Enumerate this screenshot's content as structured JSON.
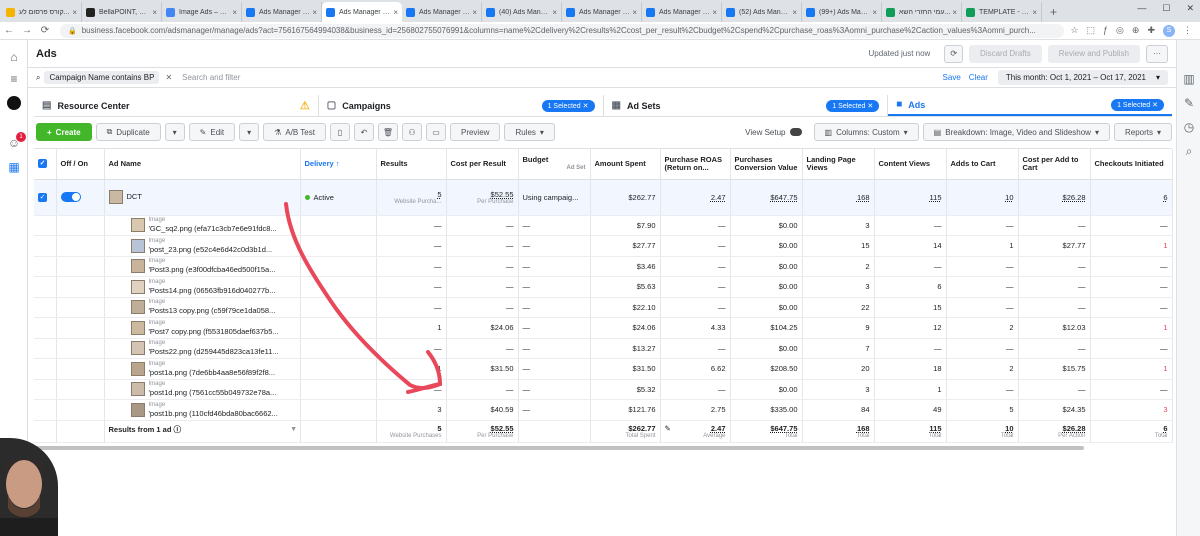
{
  "browser": {
    "tabs": [
      {
        "title": "קורס פרסום לע...",
        "color": "#f4b400"
      },
      {
        "title": "BellaPOINT, Onl...",
        "color": "#222222"
      },
      {
        "title": "Image Ads – Go...",
        "color": "#4285f4"
      },
      {
        "title": "Ads Manager - ...",
        "color": "#1877f2"
      },
      {
        "title": "Ads Manager - ...",
        "color": "#1877f2",
        "active": true
      },
      {
        "title": "Ads Manager - ...",
        "color": "#1877f2"
      },
      {
        "title": "(40) Ads Manag...",
        "color": "#1877f2"
      },
      {
        "title": "Ads Manager - ...",
        "color": "#1877f2"
      },
      {
        "title": "Ads Manager - ...",
        "color": "#1877f2"
      },
      {
        "title": "(52) Ads Manag...",
        "color": "#1877f2"
      },
      {
        "title": "(99+) Ads Mana...",
        "color": "#1877f2"
      },
      {
        "title": "עמי החזרי השא...",
        "color": "#0f9d58"
      },
      {
        "title": "TEMPLATE - KP...",
        "color": "#0f9d58"
      }
    ],
    "new_tab": "+",
    "url": "business.facebook.com/adsmanager/manage/ads?act=756167564994038&business_id=256802755076991&columns=name%2Cdelivery%2Cresults%2Ccost_per_result%2Cbudget%2Cspend%2Cpurchase_roas%3Aomni_purchase%2Caction_values%3Aomni_purch...",
    "profile_initial": "S"
  },
  "rail": {
    "notification_count": "1"
  },
  "header": {
    "title": "Ads",
    "updated": "Updated just now",
    "discard": "Discard Drafts",
    "review": "Review and Publish",
    "more": "···"
  },
  "search": {
    "chip": "Campaign Name contains BP",
    "placeholder": "Search and filter",
    "save": "Save",
    "clear": "Clear",
    "date_range": "This month: Oct 1, 2021 – Oct 17, 2021"
  },
  "levels": {
    "resource_center": "Resource Center",
    "campaigns": "Campaigns",
    "campaigns_selected": "1 Selected",
    "ad_sets": "Ad Sets",
    "ad_sets_selected": "1 Selected",
    "ads": "Ads",
    "ads_selected": "1 Selected"
  },
  "toolbar": {
    "create": "Create",
    "duplicate": "Duplicate",
    "edit": "Edit",
    "ab_test": "A/B Test",
    "preview": "Preview",
    "rules": "Rules",
    "view_setup": "View Setup",
    "columns": "Columns: Custom",
    "breakdown": "Breakdown: Image, Video and Slideshow",
    "reports": "Reports"
  },
  "table": {
    "headers": {
      "onoff": "Off / On",
      "name": "Ad Name",
      "delivery": "Delivery ↑",
      "results": "Results",
      "cpr": "Cost per Result",
      "budget": "Budget",
      "budget_sub": "Ad Set",
      "spent": "Amount Spent",
      "roas": "Purchase ROAS (Return on...",
      "pcv": "Purchases Conversion Value",
      "lpv": "Landing Page Views",
      "cv": "Content Views",
      "atc": "Adds to Cart",
      "cpatc": "Cost per Add to Cart",
      "ci": "Checkouts Initiated"
    },
    "parent": {
      "name": "DCT",
      "delivery": "Active",
      "results": "5",
      "results_sub": "Website Purcha...",
      "cpr": "$52.55",
      "cpr_sub": "Per Purchase",
      "budget": "Using campaig...",
      "spent": "$262.77",
      "roas": "2.47",
      "pcv": "$647.75",
      "lpv": "168",
      "cv": "115",
      "atc": "10",
      "cpatc": "$26.28",
      "ci": "6"
    },
    "image_label": "Image",
    "rows": [
      {
        "name": "'GC_sq2.png (efa71c3cb7e6e91fdc8...",
        "results": "—",
        "cpr": "—",
        "budget": "—",
        "spent": "$7.90",
        "roas": "—",
        "pcv": "$0.00",
        "lpv": "3",
        "cv": "—",
        "atc": "—",
        "cpatc": "—",
        "ci": "—"
      },
      {
        "name": "'post_23.png (e52c4e6d42c0d3b1d...",
        "results": "—",
        "cpr": "—",
        "budget": "—",
        "spent": "$27.77",
        "roas": "—",
        "pcv": "$0.00",
        "lpv": "15",
        "cv": "14",
        "atc": "1",
        "cpatc": "$27.77",
        "ci": "1"
      },
      {
        "name": "'Post3.png (e3f00dfcba46ed500f15a...",
        "results": "—",
        "cpr": "—",
        "budget": "—",
        "spent": "$3.46",
        "roas": "—",
        "pcv": "$0.00",
        "lpv": "2",
        "cv": "—",
        "atc": "—",
        "cpatc": "—",
        "ci": "—"
      },
      {
        "name": "'Posts14.png (06563fb916d040277b...",
        "results": "—",
        "cpr": "—",
        "budget": "—",
        "spent": "$5.63",
        "roas": "—",
        "pcv": "$0.00",
        "lpv": "3",
        "cv": "6",
        "atc": "—",
        "cpatc": "—",
        "ci": "—"
      },
      {
        "name": "'Posts13 copy.png (c59f79ce1da058...",
        "results": "—",
        "cpr": "—",
        "budget": "—",
        "spent": "$22.10",
        "roas": "—",
        "pcv": "$0.00",
        "lpv": "22",
        "cv": "15",
        "atc": "—",
        "cpatc": "—",
        "ci": "—"
      },
      {
        "name": "'Post7 copy.png (f5531805daef637b5...",
        "results": "1",
        "cpr": "$24.06",
        "budget": "—",
        "spent": "$24.06",
        "roas": "4.33",
        "pcv": "$104.25",
        "lpv": "9",
        "cv": "12",
        "atc": "2",
        "cpatc": "$12.03",
        "ci": "1"
      },
      {
        "name": "'Posts22.png (d259445d823ca13fe11...",
        "results": "—",
        "cpr": "—",
        "budget": "—",
        "spent": "$13.27",
        "roas": "—",
        "pcv": "$0.00",
        "lpv": "7",
        "cv": "—",
        "atc": "—",
        "cpatc": "—",
        "ci": "—"
      },
      {
        "name": "'post1a.png (7de6bb4aa8e56f89f2f8...",
        "results": "1",
        "cpr": "$31.50",
        "budget": "—",
        "spent": "$31.50",
        "roas": "6.62",
        "pcv": "$208.50",
        "lpv": "20",
        "cv": "18",
        "atc": "2",
        "cpatc": "$15.75",
        "ci": "1"
      },
      {
        "name": "'post1d.png (7561cc55b049732e78a...",
        "results": "—",
        "cpr": "—",
        "budget": "—",
        "spent": "$5.32",
        "roas": "—",
        "pcv": "$0.00",
        "lpv": "3",
        "cv": "1",
        "atc": "—",
        "cpatc": "—",
        "ci": "—"
      },
      {
        "name": "'post1b.png (110cfd46bda80bac6662...",
        "results": "3",
        "cpr": "$40.59",
        "budget": "—",
        "spent": "$121.76",
        "roas": "2.75",
        "pcv": "$335.00",
        "lpv": "84",
        "cv": "49",
        "atc": "5",
        "cpatc": "$24.35",
        "ci": "3"
      }
    ],
    "totals": {
      "label": "Results from 1 ad",
      "results": "5",
      "results_sub": "Website Purchases",
      "cpr": "$52.55",
      "cpr_sub": "Per Purchase",
      "budget": "",
      "spent": "$262.77",
      "spent_sub": "Total Spent",
      "roas": "2.47",
      "roas_sub": "Average",
      "pcv": "$647.75",
      "pcv_sub": "Total",
      "lpv": "168",
      "lpv_sub": "Total",
      "cv": "115",
      "cv_sub": "Total",
      "atc": "10",
      "atc_sub": "Total",
      "cpatc": "$26.28",
      "cpatc_sub": "Per Action",
      "ci": "6",
      "ci_sub": "Total"
    }
  },
  "colors": {
    "accent": "#1877f2",
    "green": "#42b72a",
    "annotation": "#e8485a",
    "active_dot": "#42b72a"
  }
}
